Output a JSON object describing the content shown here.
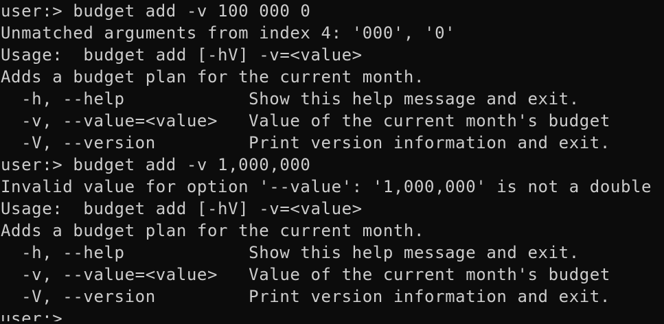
{
  "terminal": {
    "lines": [
      "user:> budget add -v 100 000 0",
      "Unmatched arguments from index 4: '000', '0'",
      "Usage:  budget add [-hV] -v=<value>",
      "Adds a budget plan for the current month.",
      "  -h, --help            Show this help message and exit.",
      "  -v, --value=<value>   Value of the current month's budget",
      "  -V, --version         Print version information and exit.",
      "user:> budget add -v 1,000,000",
      "Invalid value for option '--value': '1,000,000' is not a double",
      "Usage:  budget add [-hV] -v=<value>",
      "Adds a budget plan for the current month.",
      "  -h, --help            Show this help message and exit.",
      "  -v, --value=<value>   Value of the current month's budget",
      "  -V, --version         Print version information and exit.",
      "user:>"
    ]
  },
  "colors": {
    "background": "#0c0c0c",
    "text": "#cccccc"
  }
}
